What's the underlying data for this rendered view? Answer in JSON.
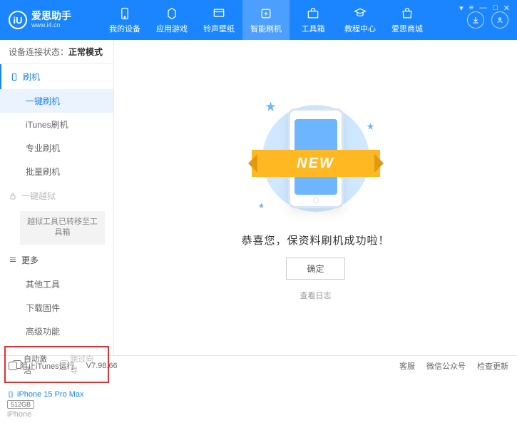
{
  "header": {
    "logo_letter": "iU",
    "app_name": "爱思助手",
    "url": "www.i4.cn",
    "nav": [
      {
        "label": "我的设备"
      },
      {
        "label": "应用游戏"
      },
      {
        "label": "铃声壁纸"
      },
      {
        "label": "智能刷机"
      },
      {
        "label": "工具箱"
      },
      {
        "label": "教程中心"
      },
      {
        "label": "爱思商城"
      }
    ]
  },
  "sidebar": {
    "status_label": "设备连接状态：",
    "status_value": "正常模式",
    "sections": {
      "flash": {
        "label": "刷机",
        "items": [
          "一键刷机",
          "iTunes刷机",
          "专业刷机",
          "批量刷机"
        ]
      },
      "jailbreak": {
        "label": "一键越狱",
        "boxed": "越狱工具已转移至工具箱"
      },
      "more": {
        "label": "更多",
        "items": [
          "其他工具",
          "下载固件",
          "高级功能"
        ]
      }
    },
    "checks": {
      "auto_activate": "自动激活",
      "skip_setup": "跳过向导"
    },
    "device": {
      "name": "iPhone 15 Pro Max",
      "storage": "512GB",
      "model": "iPhone"
    }
  },
  "main": {
    "ribbon": "NEW",
    "success": "恭喜您，保资料刷机成功啦！",
    "ok": "确定",
    "log": "查看日志"
  },
  "footer": {
    "block_itunes": "阻止iTunes运行",
    "version": "V7.98.66",
    "links": [
      "客服",
      "微信公众号",
      "检查更新"
    ]
  }
}
